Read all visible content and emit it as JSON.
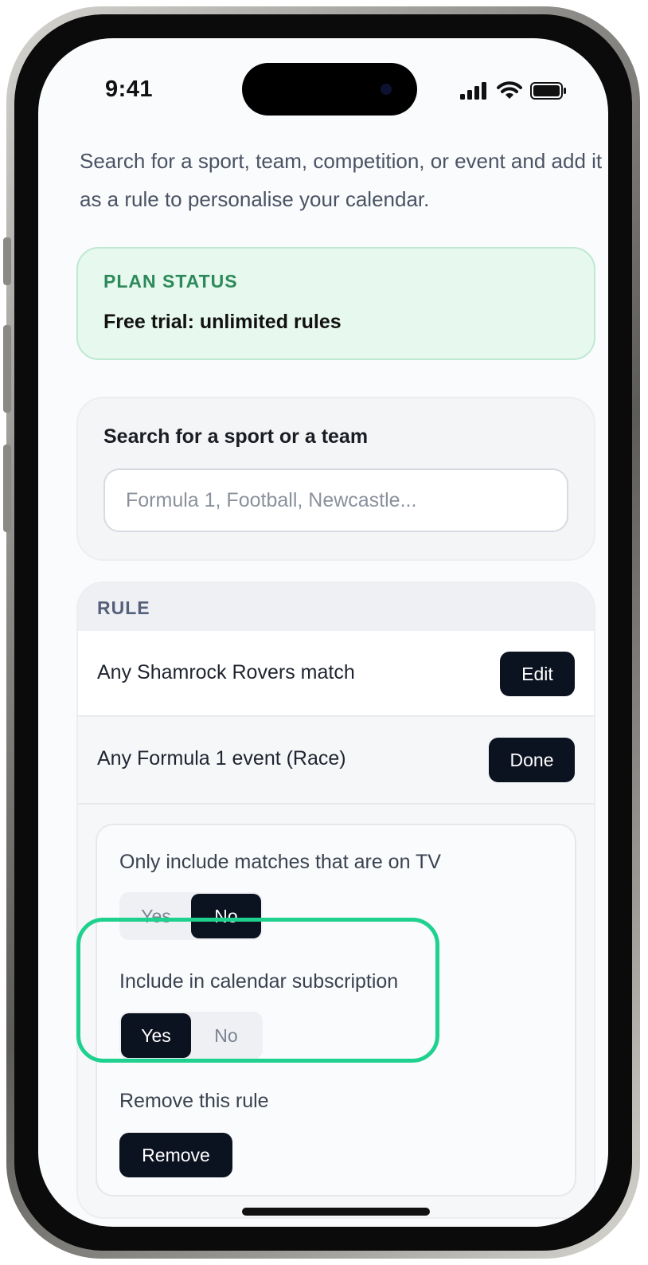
{
  "status_bar": {
    "time": "9:41"
  },
  "intro_text": "Search for a sport, team, competition, or event and add it as a rule to personalise your calendar.",
  "plan": {
    "label": "PLAN STATUS",
    "value": "Free trial: unlimited rules"
  },
  "search": {
    "title": "Search for a sport or a team",
    "placeholder": "Formula 1, Football, Newcastle..."
  },
  "rules": {
    "header": "RULE",
    "items": [
      {
        "label": "Any Shamrock Rovers match",
        "button": "Edit"
      },
      {
        "label": "Any Formula 1 event (Race)",
        "button": "Done"
      }
    ],
    "options": {
      "tv_label": "Only include matches that are on TV",
      "tv_yes": "Yes",
      "tv_no": "No",
      "tv_selected": "No",
      "sub_label": "Include in calendar subscription",
      "sub_yes": "Yes",
      "sub_no": "No",
      "sub_selected": "Yes",
      "remove_label": "Remove this rule",
      "remove_button": "Remove"
    }
  },
  "colors": {
    "accent_highlight": "#1fd18e",
    "dark_button": "#0b1220",
    "plan_green": "#2c8a5a"
  }
}
